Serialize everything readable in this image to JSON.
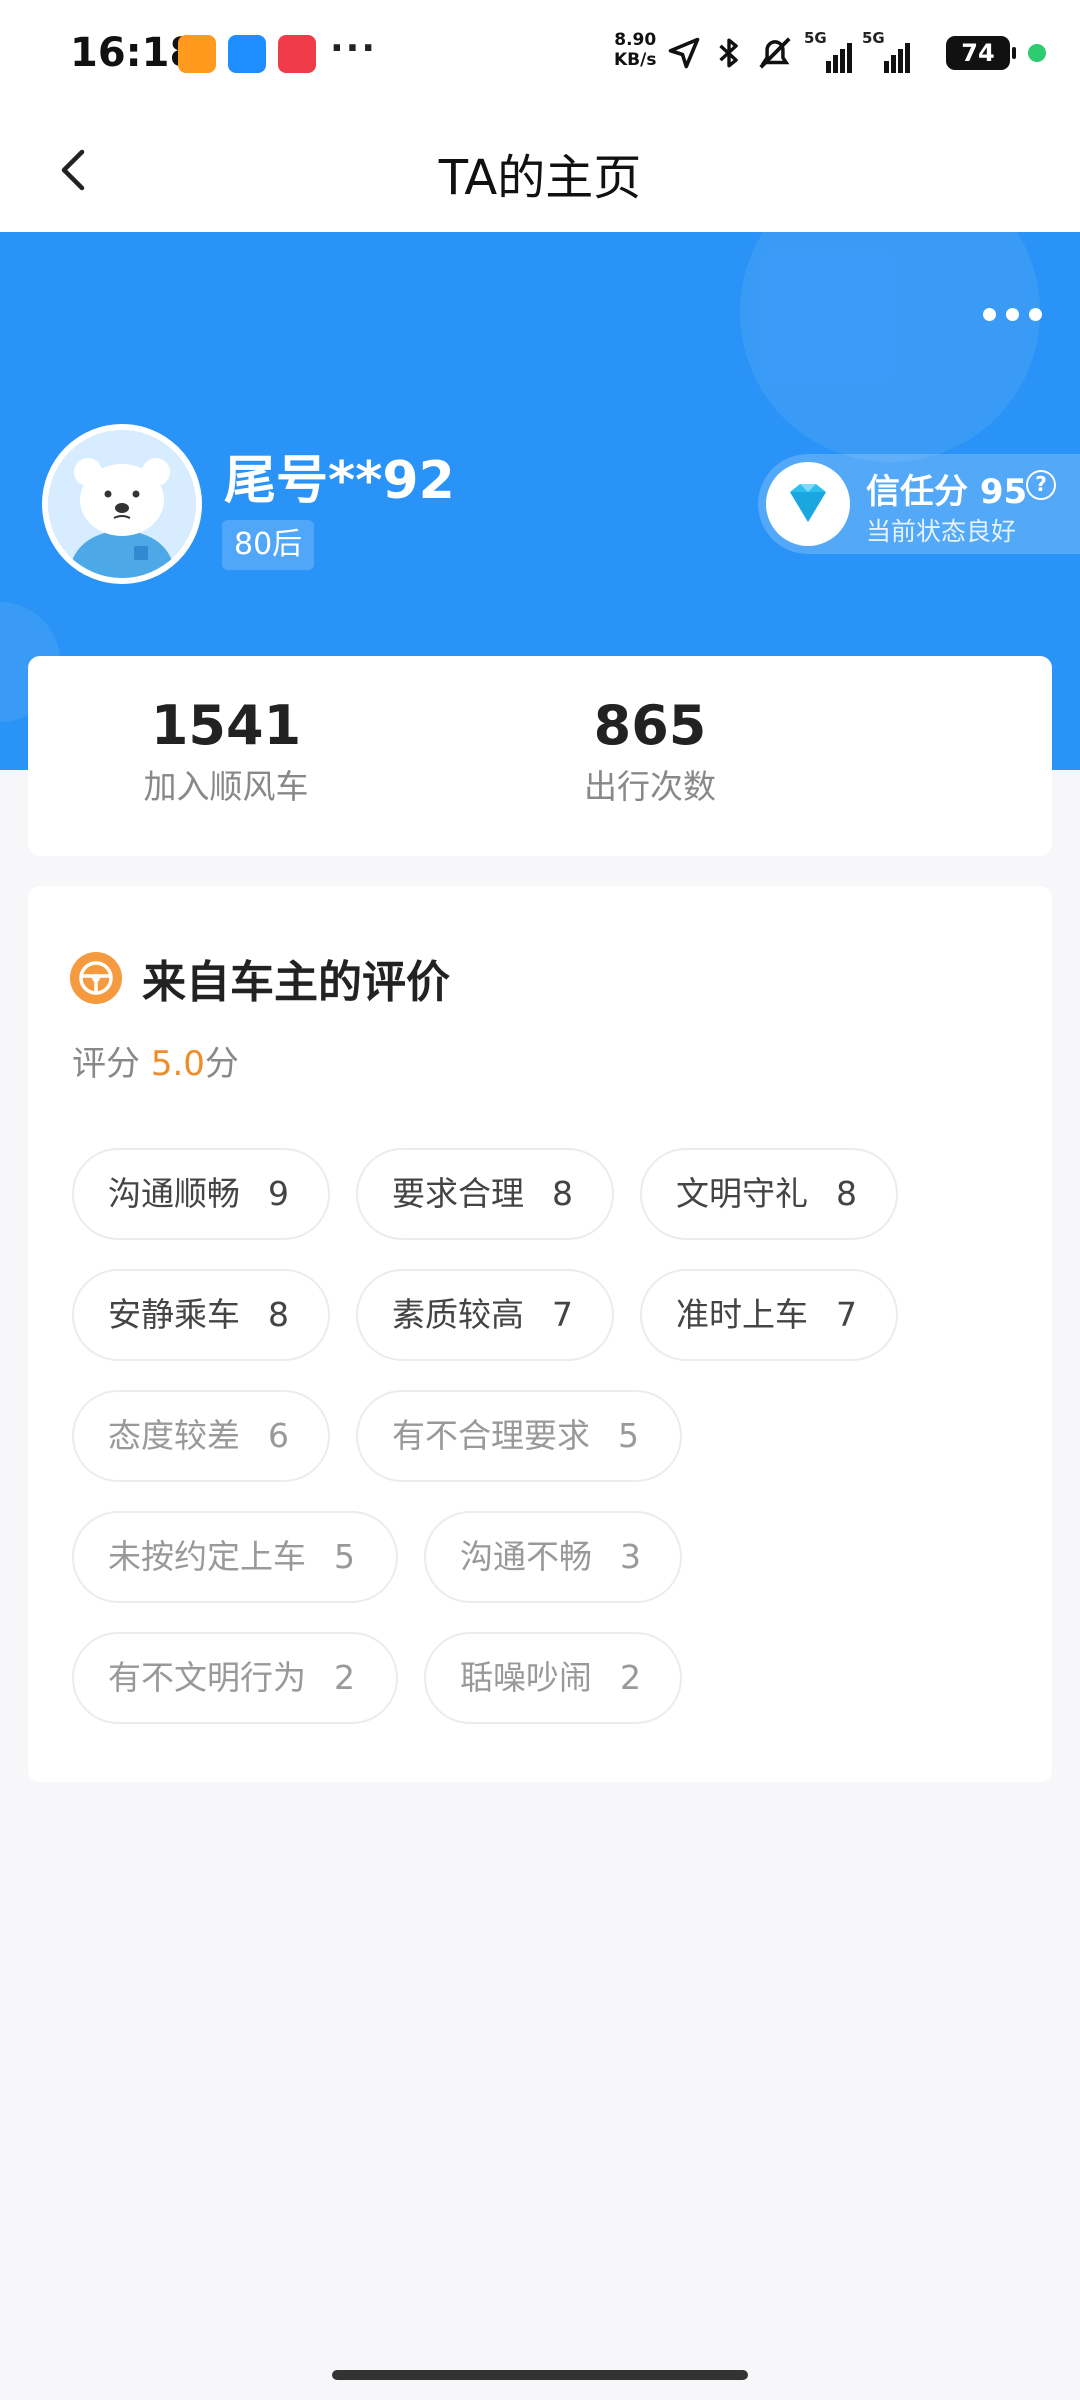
{
  "status_bar": {
    "time": "16:18",
    "more": "···",
    "speed_value": "8.90",
    "speed_unit": "KB/s",
    "network_1": "5G",
    "network_2": "5G",
    "battery": "74"
  },
  "header": {
    "title": "TA的主页"
  },
  "profile": {
    "nickname": "尾号**92",
    "age_tag": "80后",
    "trust_title": "信任分 95",
    "trust_help": "?",
    "trust_status": "当前状态良好"
  },
  "stats": [
    {
      "value": "1541",
      "label": "加入顺风车"
    },
    {
      "value": "865",
      "label": "出行次数"
    }
  ],
  "reviews": {
    "title": "来自车主的评价",
    "score_label": "评分",
    "score_value": "5.0",
    "score_unit": "分",
    "tags": [
      {
        "label": "沟通顺畅",
        "count": "9",
        "sentiment": "positive"
      },
      {
        "label": "要求合理",
        "count": "8",
        "sentiment": "positive"
      },
      {
        "label": "文明守礼",
        "count": "8",
        "sentiment": "positive"
      },
      {
        "label": "安静乘车",
        "count": "8",
        "sentiment": "positive"
      },
      {
        "label": "素质较高",
        "count": "7",
        "sentiment": "positive"
      },
      {
        "label": "准时上车",
        "count": "7",
        "sentiment": "positive"
      },
      {
        "label": "态度较差",
        "count": "6",
        "sentiment": "negative"
      },
      {
        "label": "有不合理要求",
        "count": "5",
        "sentiment": "negative"
      },
      {
        "label": "未按约定上车",
        "count": "5",
        "sentiment": "negative"
      },
      {
        "label": "沟通不畅",
        "count": "3",
        "sentiment": "negative"
      },
      {
        "label": "有不文明行为",
        "count": "2",
        "sentiment": "negative"
      },
      {
        "label": "聒噪吵闹",
        "count": "2",
        "sentiment": "negative"
      }
    ]
  },
  "colors": {
    "brand_blue": "#2a93f7",
    "score_orange": "#f08c28",
    "review_icon": "#f59a3e"
  }
}
